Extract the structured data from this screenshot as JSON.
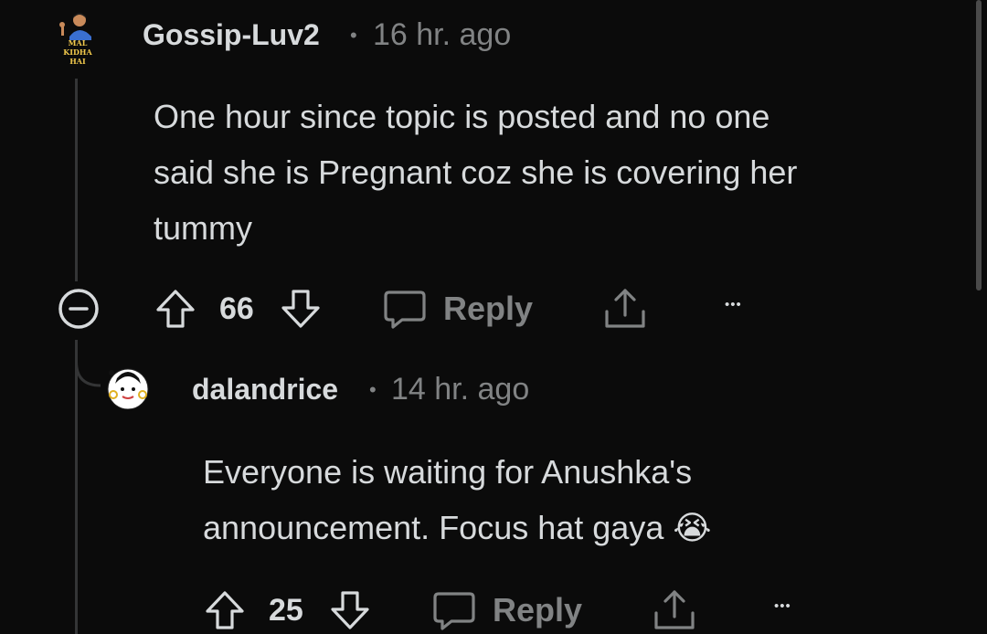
{
  "comment1": {
    "avatar_text": [
      "MAL KIDHA",
      "HAI"
    ],
    "username": "Gossip-Luv2",
    "separator": "•",
    "time": "16 hr. ago",
    "body_lines": [
      "One hour since topic is posted and no one",
      "said she is Pregnant coz she is covering her",
      "tummy"
    ],
    "votes": "66",
    "reply_label": "Reply",
    "more_label": "•••"
  },
  "comment2": {
    "username": "dalandrice",
    "separator": "•",
    "time": "14 hr. ago",
    "body_lines": [
      "Everyone is waiting for Anushka's",
      "announcement. Focus hat gaya"
    ],
    "emoji": "😭",
    "votes": "25",
    "reply_label": "Reply",
    "more_label": "•••"
  },
  "colors": {
    "background": "#0b0b0b",
    "text": "#d7dadc",
    "muted": "#818384",
    "thread_line": "#343536"
  }
}
